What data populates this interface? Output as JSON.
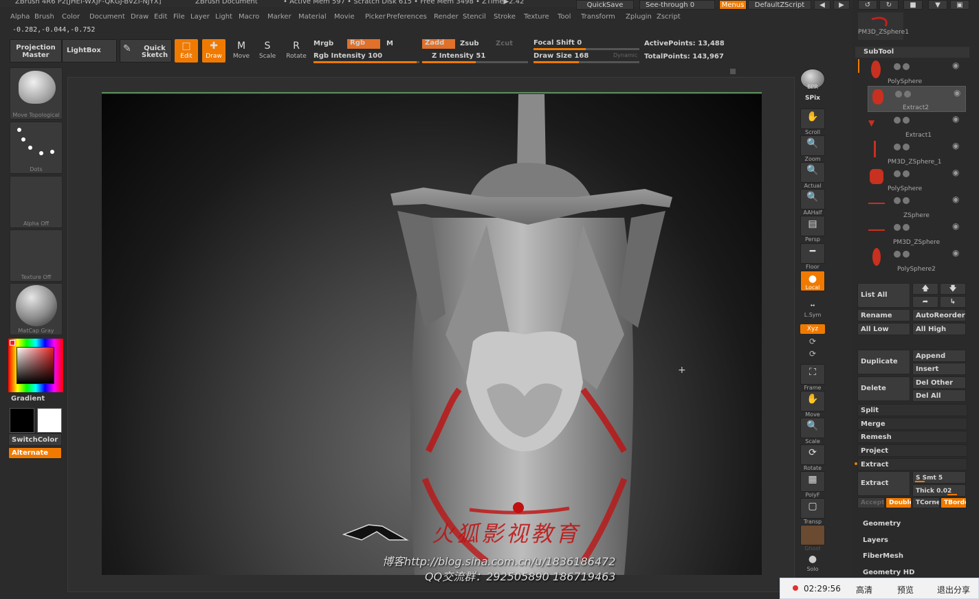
{
  "titlebar": {
    "app": "ZBrush 4R6 P2[JHEI-WXJF-QKGJ-BVZI-NJYX]",
    "doc": "ZBrush Document",
    "mem": "• Active Mem 597 • Scratch Disk 615 • Free Mem 3498 • ZTime▶2.42",
    "quicksave": "QuickSave",
    "seethrough": "See-through  0",
    "menus": "Menus",
    "script": "DefaultZScript"
  },
  "menubar": [
    "Alpha",
    "Brush",
    "Color",
    "Document",
    "Draw",
    "Edit",
    "File",
    "Layer",
    "Light",
    "Macro",
    "Marker",
    "Material",
    "Movie",
    "Picker",
    "Preferences",
    "Render",
    "Stencil",
    "Stroke",
    "Texture",
    "Tool",
    "Transform",
    "Zplugin",
    "Zscript"
  ],
  "coords": "-0.282,-0.044,-0.752",
  "shelf": {
    "projection_master": "Projection Master",
    "lightbox": "LightBox",
    "quick_sketch": "Quick Sketch",
    "edit": "Edit",
    "draw": "Draw",
    "move": "Move",
    "scale": "Scale",
    "rotate": "Rotate",
    "mrgb": "Mrgb",
    "rgb": "Rgb",
    "m": "M",
    "rgb_intensity": "Rgb Intensity 100",
    "zadd": "Zadd",
    "zsub": "Zsub",
    "zcut": "Zcut",
    "z_intensity": "Z Intensity 51",
    "focal_shift": "Focal Shift 0",
    "draw_size": "Draw Size 168",
    "dynamic": "Dynamic",
    "active_points": "ActivePoints: 13,488",
    "total_points": "TotalPoints: 143,967"
  },
  "left": {
    "brush_caption": "Move Topological",
    "stroke_caption": "Dots",
    "alpha_caption": "Alpha Off",
    "texture_caption": "Texture Off",
    "material_caption": "MatCap Gray",
    "gradient": "Gradient",
    "switchcolor": "SwitchColor",
    "alternate": "Alternate"
  },
  "righttools": [
    "BPR",
    "SPix",
    "Scroll",
    "Zoom",
    "Actual",
    "AAHalf",
    "Persp",
    "Floor",
    "Local",
    "L.Sym",
    "Xyz",
    "Frame",
    "Move",
    "Scale",
    "Rotate",
    "PolyF",
    "Transp",
    "Ghost",
    "Solo"
  ],
  "subtool": {
    "current": "PM3D_ZSphere1",
    "header": "SubTool",
    "items": [
      "PolySphere",
      "Extract2",
      "Extract1",
      "PM3D_ZSphere_1",
      "PolySphere",
      "ZSphere",
      "PM3D_ZSphere",
      "PolySphere2"
    ],
    "list_all": "List All",
    "rename": "Rename",
    "autoreorder": "AutoReorder",
    "all_low": "All Low",
    "all_high": "All High",
    "duplicate": "Duplicate",
    "append": "Append",
    "insert": "Insert",
    "delete": "Delete",
    "del_other": "Del Other",
    "del_all": "Del All",
    "split": "Split",
    "merge": "Merge",
    "remesh": "Remesh",
    "project": "Project",
    "extract_header": "Extract",
    "extract": "Extract",
    "s_smt": "S Smt 5",
    "thick": "Thick 0.02",
    "accept": "Accept",
    "double": "Double",
    "tcorner": "TCorner",
    "tborder": "TBorder",
    "geometry": "Geometry",
    "layers": "Layers",
    "fibermesh": "FiberMesh",
    "geometry_hd": "Geometry HD"
  },
  "watermark": {
    "brand": "火狐影视教育",
    "blog": "博客http://blog.sina.com.cn/u/1836186472",
    "qq": "QQ交流群：292505890  186719463"
  },
  "statusbar": {
    "time": "02:29:56",
    "hd": "高清",
    "preview": "预览",
    "exit": "退出分享"
  },
  "colors": {
    "accent": "#f07a00",
    "stroke_red": "#c01010"
  }
}
